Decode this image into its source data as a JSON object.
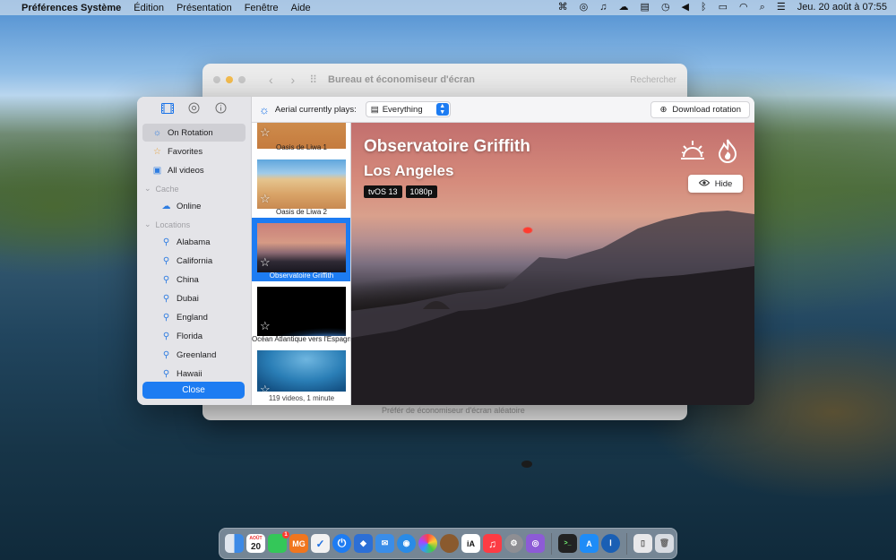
{
  "menubar": {
    "app": "Préférences Système",
    "menus": [
      "Édition",
      "Présentation",
      "Fenêtre",
      "Aide"
    ],
    "clock": "Jeu. 20 août à 07:55"
  },
  "background_window": {
    "title": "Bureau et économiseur d'écran",
    "search_placeholder": "Rechercher",
    "bottom_text": "Préfér de économiseur d'écran aléatoire"
  },
  "sidebar": {
    "tabs": [
      {
        "icon": "film-icon"
      },
      {
        "icon": "gear-icon"
      },
      {
        "icon": "info-icon"
      }
    ],
    "on_rotation": "On Rotation",
    "favorites": "Favorites",
    "all_videos": "All videos",
    "cache_header": "Cache",
    "online": "Online",
    "locations_header": "Locations",
    "locations": [
      "Alabama",
      "California",
      "China",
      "Dubai",
      "England",
      "Florida",
      "Greenland",
      "Hawaii"
    ],
    "close_label": "Close"
  },
  "toolbar": {
    "label": "Aerial currently plays:",
    "selected": "Everything",
    "download_label": "Download rotation"
  },
  "thumbnails": [
    {
      "caption": "Oasis de Liwa 1"
    },
    {
      "caption": "Oasis de Liwa 2"
    },
    {
      "caption": "Observatoire Griffith"
    },
    {
      "caption": "Océan Atlantique vers l'Espagne"
    },
    {
      "caption": ""
    }
  ],
  "thumbnails_footer": "119 videos, 1 minute",
  "preview": {
    "title": "Observatoire Griffith",
    "subtitle": "Los Angeles",
    "badges": [
      "tvOS 13",
      "1080p"
    ],
    "hide_label": "Hide"
  },
  "dock": {
    "calendar_month": "AOÛT",
    "calendar_day": "20",
    "messages_badge": "1",
    "mg_label": "MG",
    "ia_label": "iA"
  },
  "colors": {
    "accent": "#1d7cf2",
    "selection": "#cfcfd4",
    "star": "#e6a23c"
  }
}
